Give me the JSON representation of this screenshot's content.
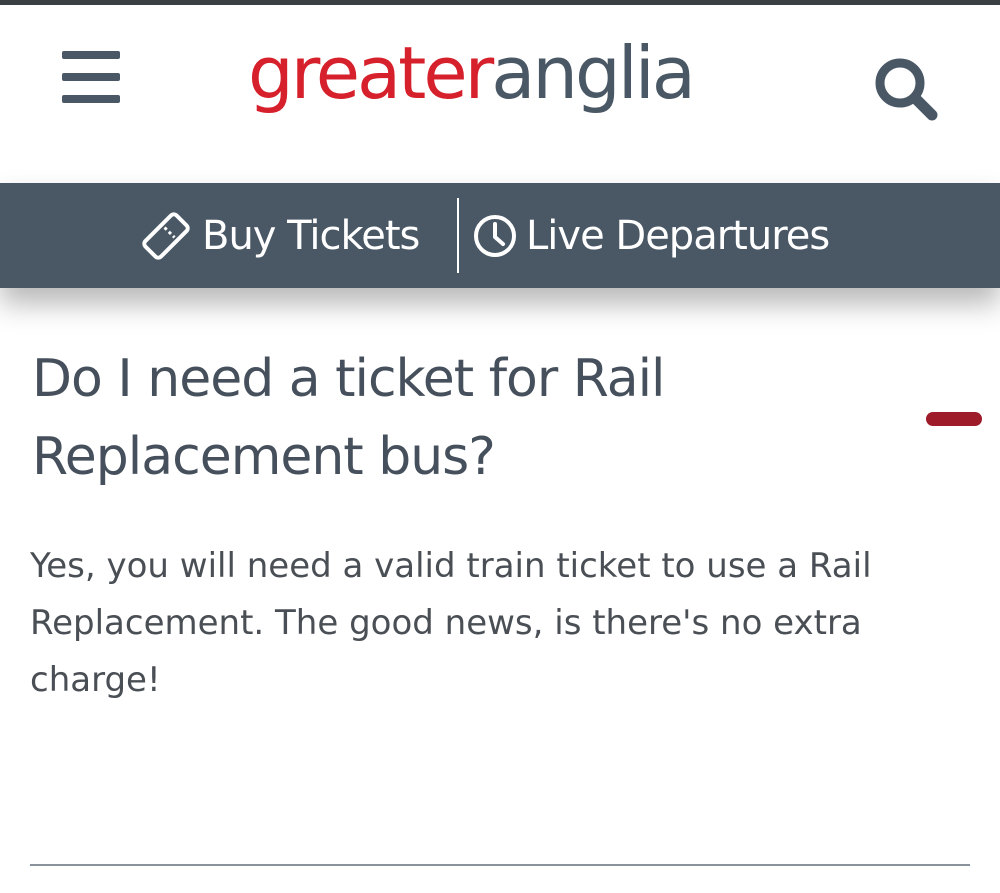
{
  "header": {
    "menu_icon": "hamburger-menu-icon",
    "logo": {
      "part_a": "greater",
      "part_b": "anglia",
      "color_a": "#d6202b",
      "color_b": "#4a5866"
    },
    "search_icon": "search-icon"
  },
  "nav": {
    "background": "#4a5866",
    "items": [
      {
        "label": "Buy Tickets",
        "icon": "ticket-icon"
      },
      {
        "label": "Live Departures",
        "icon": "clock-icon"
      }
    ]
  },
  "faq": {
    "question": "Do I need a ticket for Rail Replacement bus?",
    "answer": "Yes, you will need a valid train ticket to use a Rail Replacement. The good news, is there's no extra charge!",
    "toggle_icon": "collapse-minus-icon",
    "toggle_color": "#9e1b2a",
    "expanded": true
  }
}
